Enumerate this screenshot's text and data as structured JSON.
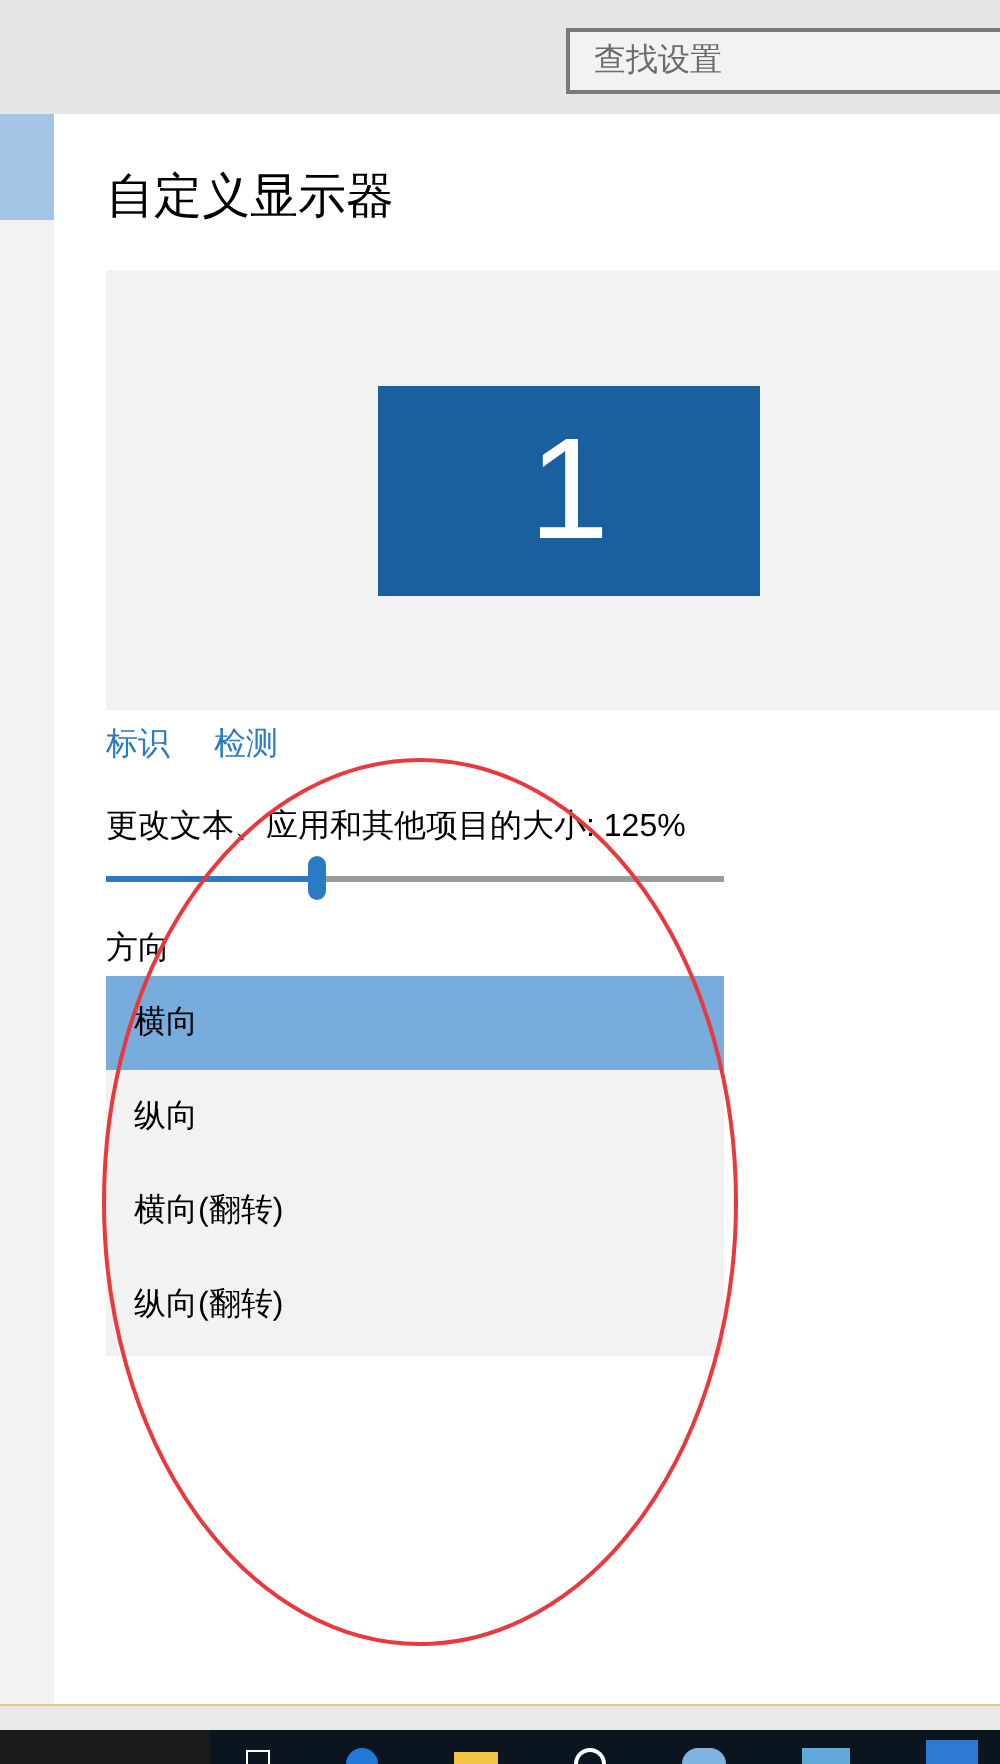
{
  "search": {
    "placeholder": "查找设置"
  },
  "sidebar": {
    "items": [
      {
        "selected": true
      }
    ]
  },
  "title": "自定义显示器",
  "display": {
    "label": "1"
  },
  "links": [
    "标识",
    "检测"
  ],
  "scale": {
    "label": "更改文本、应用和其他项目的大小: 125%",
    "level": 0.34
  },
  "orientation": {
    "label": "方向",
    "options": [
      {
        "label": "横向",
        "selected": true
      },
      {
        "label": "纵向",
        "selected": false
      },
      {
        "label": "横向(翻转)",
        "selected": false
      },
      {
        "label": "纵向(翻转)",
        "selected": false
      }
    ]
  }
}
